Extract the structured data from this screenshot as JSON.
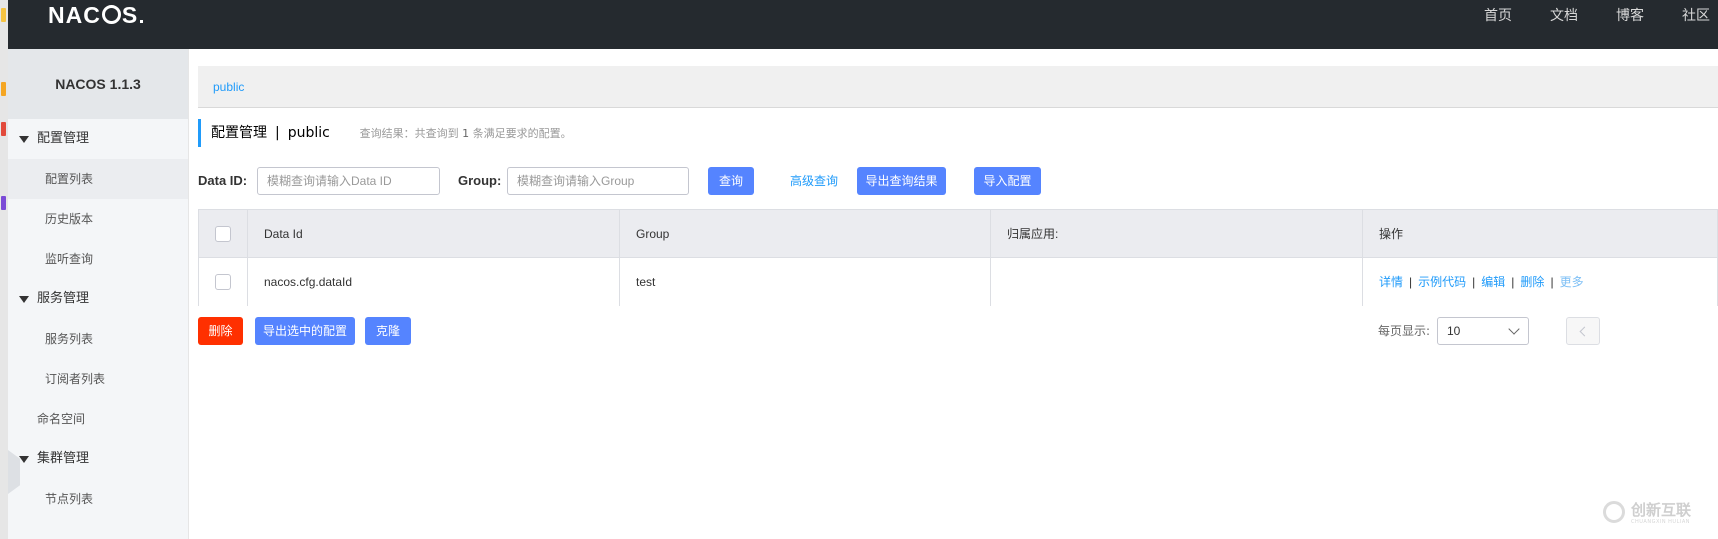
{
  "header": {
    "logo": "NACOS",
    "nav": [
      "首页",
      "文档",
      "博客",
      "社区"
    ]
  },
  "sidebar": {
    "brand": "NACOS 1.1.3",
    "groups": [
      {
        "label": "配置管理",
        "items": [
          "配置列表",
          "历史版本",
          "监听查询"
        ]
      },
      {
        "label": "服务管理",
        "items": [
          "服务列表",
          "订阅者列表"
        ]
      },
      {
        "label": "命名空间"
      },
      {
        "label": "集群管理",
        "items": [
          "节点列表"
        ]
      }
    ]
  },
  "breadcrumb": {
    "namespace": "public"
  },
  "title": {
    "main": "配置管理",
    "separator": "|",
    "namespace": "public",
    "result_prefix": "查询结果：共查询到",
    "result_count": "1",
    "result_suffix": "条满足要求的配置。"
  },
  "search": {
    "data_id_label": "Data ID:",
    "data_id_placeholder": "模糊查询请输入Data ID",
    "group_label": "Group:",
    "group_placeholder": "模糊查询请输入Group",
    "query_button": "查询",
    "advanced_link": "高级查询",
    "export_button": "导出查询结果",
    "import_button": "导入配置"
  },
  "table": {
    "columns": [
      "Data Id",
      "Group",
      "归属应用:",
      "操作"
    ],
    "rows": [
      {
        "data_id": "nacos.cfg.dataId",
        "group": "test",
        "app": ""
      }
    ],
    "ops": [
      "详情",
      "示例代码",
      "编辑",
      "删除",
      "更多"
    ]
  },
  "bottom": {
    "delete_button": "删除",
    "export_selected_button": "导出选中的配置",
    "clone_button": "克隆",
    "page_size_label": "每页显示:",
    "page_size_value": "10"
  },
  "watermark": {
    "text": "创新互联",
    "sub": "CHUANGXIN HULIAN"
  },
  "colors": {
    "accent": "#5584ff",
    "link": "#209bfa",
    "danger": "#ff3000",
    "header_bg": "#252a2f"
  }
}
